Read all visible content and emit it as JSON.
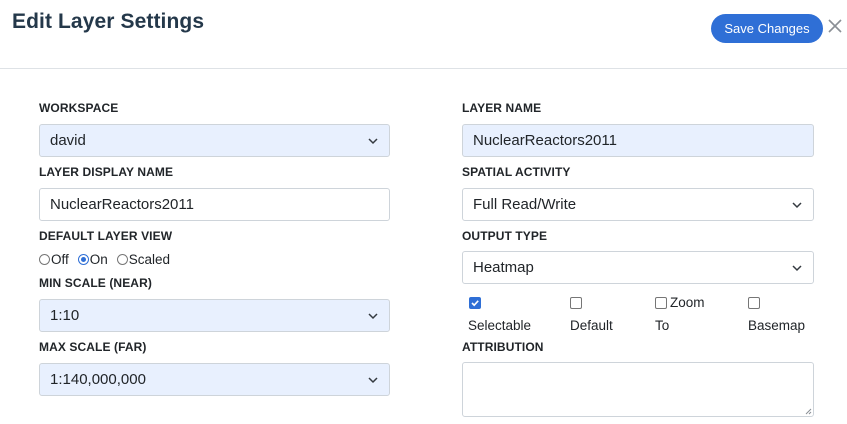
{
  "header": {
    "title": "Edit Layer Settings",
    "save_label": "Save Changes",
    "close_icon": "close-icon"
  },
  "left": {
    "workspace": {
      "label": "WORKSPACE",
      "value": "david"
    },
    "layer_display_name": {
      "label": "LAYER DISPLAY NAME",
      "value": "NuclearReactors2011"
    },
    "default_layer_view": {
      "label": "DEFAULT LAYER VIEW",
      "options": [
        "Off",
        "On",
        "Scaled"
      ],
      "selected": "On"
    },
    "min_scale": {
      "label": "MIN SCALE (NEAR)",
      "value": "1:10"
    },
    "max_scale": {
      "label": "MAX SCALE (FAR)",
      "value": "1:140,000,000"
    }
  },
  "right": {
    "layer_name": {
      "label": "LAYER NAME",
      "value": "NuclearReactors2011"
    },
    "spatial_activity": {
      "label": "SPATIAL ACTIVITY",
      "value": "Full Read/Write"
    },
    "output_type": {
      "label": "OUTPUT TYPE",
      "value": "Heatmap"
    },
    "checkboxes": [
      {
        "label": "Selectable",
        "checked": true
      },
      {
        "label": "Default",
        "checked": false
      },
      {
        "label_line1": "Zoom",
        "label_line2": "To",
        "checked": false
      },
      {
        "label": "Basemap",
        "checked": false
      }
    ],
    "attribution": {
      "label": "ATTRIBUTION",
      "value": ""
    }
  },
  "colors": {
    "primary": "#2f6fd6",
    "title": "#24384a",
    "filled_field": "#e8f0fe",
    "border": "#ced4da"
  }
}
